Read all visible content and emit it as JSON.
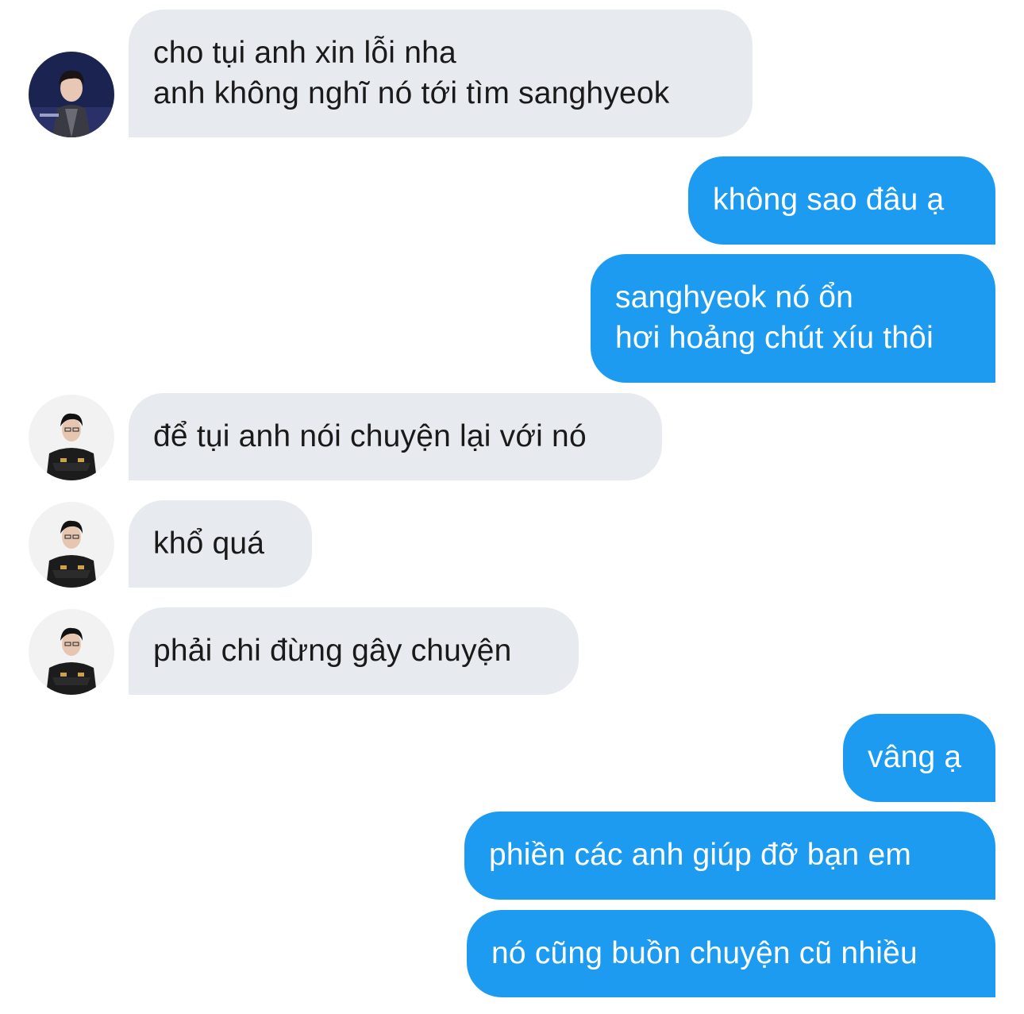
{
  "conversation": {
    "messages": [
      {
        "direction": "incoming",
        "avatar": "avatar-a",
        "lines": [
          "cho tụi anh xin lỗi nha",
          "anh không nghĩ nó tới tìm sanghyeok"
        ]
      },
      {
        "direction": "outgoing",
        "lines": [
          "không sao đâu ạ"
        ]
      },
      {
        "direction": "outgoing",
        "lines": [
          "sanghyeok nó ổn",
          "hơi hoảng chút xíu thôi"
        ]
      },
      {
        "direction": "incoming",
        "avatar": "avatar-b",
        "lines": [
          "để tụi anh nói chuyện lại với nó"
        ]
      },
      {
        "direction": "incoming",
        "avatar": "avatar-b",
        "lines": [
          "khổ quá"
        ]
      },
      {
        "direction": "incoming",
        "avatar": "avatar-b",
        "lines": [
          "phải chi đừng gây chuyện"
        ]
      },
      {
        "direction": "outgoing",
        "lines": [
          "vâng ạ"
        ]
      },
      {
        "direction": "outgoing",
        "lines": [
          "phiền các anh giúp đỡ bạn em"
        ]
      },
      {
        "direction": "outgoing",
        "lines": [
          "nó cũng buồn chuyện cũ nhiều"
        ]
      }
    ]
  },
  "colors": {
    "incoming_bubble": "#e7ebef",
    "outgoing_bubble": "#1d9bf0",
    "incoming_text": "#1a1a1a",
    "outgoing_text": "#ffffff"
  }
}
